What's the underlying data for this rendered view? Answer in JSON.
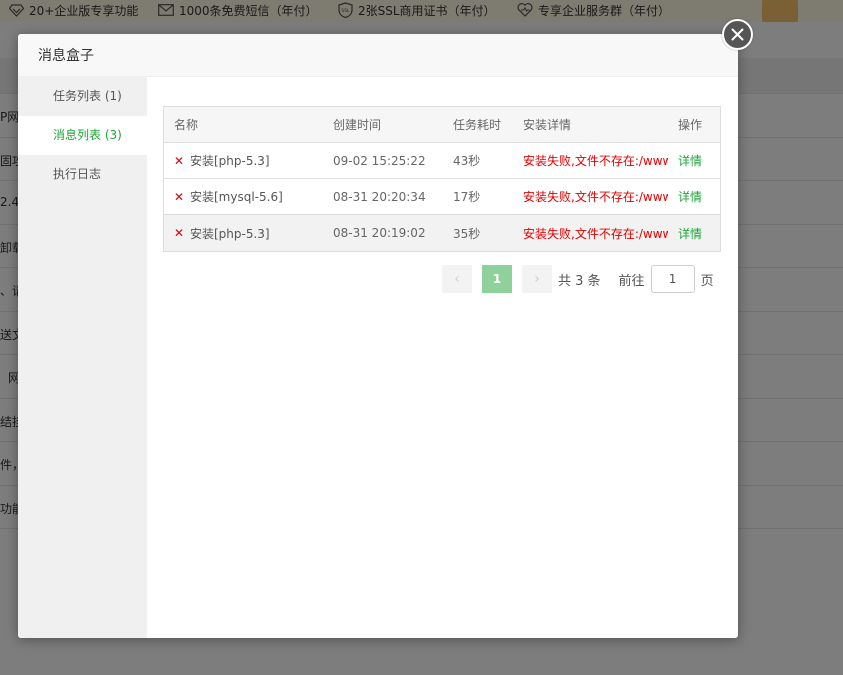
{
  "background": {
    "promo": [
      {
        "icon": "diamond-icon",
        "label": "20+企业版专享功能"
      },
      {
        "icon": "mail-icon",
        "label": "1000条免费短信（年付）"
      },
      {
        "icon": "ssl-shield-icon",
        "label": "2张SSL商用证书（年付）"
      },
      {
        "icon": "heart-service-icon",
        "label": "专享企业服务群（年付）"
      }
    ],
    "ssl_badge": "SSL",
    "row_fragments": [
      "P网",
      "固攻",
      "2.4,",
      "卸载",
      "、请",
      "送文",
      "网",
      "结挂",
      "件，",
      "功能"
    ]
  },
  "dialog": {
    "title": "消息盒子",
    "sidebar": [
      {
        "label": "任务列表 (1)",
        "active": false
      },
      {
        "label": "消息列表 (3)",
        "active": true
      },
      {
        "label": "执行日志",
        "active": false
      }
    ],
    "table": {
      "headers": [
        "名称",
        "创建时间",
        "任务耗时",
        "安装详情",
        "操作"
      ],
      "rows": [
        {
          "name": "安装[php-5.3]",
          "time": "09-02 15:25:22",
          "duration": "43秒",
          "detail": "安装失败,文件不存在:/www",
          "action": "详情"
        },
        {
          "name": "安装[mysql-5.6]",
          "time": "08-31 20:20:34",
          "duration": "17秒",
          "detail": "安装失败,文件不存在:/www",
          "action": "详情"
        },
        {
          "name": "安装[php-5.3]",
          "time": "08-31 20:19:02",
          "duration": "35秒",
          "detail": "安装失败,文件不存在:/www",
          "action": "详情"
        }
      ]
    },
    "pagination": {
      "prev": "‹",
      "next": "›",
      "current": "1",
      "total_text": "共 3 条",
      "goto_label": "前往",
      "goto_value": "1",
      "unit": "页"
    }
  },
  "colors": {
    "accent": "#20a53a",
    "error": "#e60000",
    "pager_active": "#8fd19b"
  }
}
